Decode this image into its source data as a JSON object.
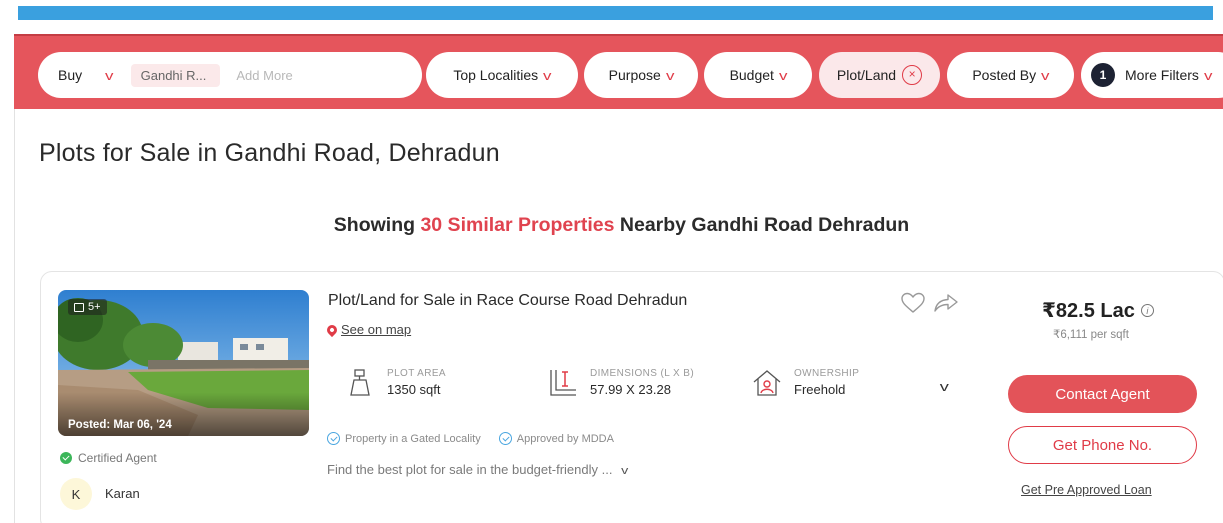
{
  "filters": {
    "buy_label": "Buy",
    "locality_chip": "Gandhi R...",
    "add_more_placeholder": "Add More",
    "top_localities": "Top Localities",
    "purpose": "Purpose",
    "budget": "Budget",
    "plot_land": "Plot/Land",
    "plot_land_clear": "×",
    "posted_by": "Posted By",
    "more_filters_count": "1",
    "more_filters": "More Filters",
    "chevron": "v"
  },
  "page_title": "Plots for Sale in Gandhi Road, Dehradun",
  "showing": {
    "prefix": "Showing ",
    "highlight": "30 Similar Properties",
    "suffix": " Nearby Gandhi Road Dehradun"
  },
  "listing": {
    "photo_count": "5+",
    "posted": "Posted: Mar 06, '24",
    "certified": "Certified Agent",
    "agent_initial": "K",
    "agent_name": "Karan",
    "title": "Plot/Land for Sale in Race Course Road Dehradun",
    "see_on_map": "See on map",
    "specs": {
      "area_label": "PLOT AREA",
      "area_value": "1350 sqft",
      "dim_label": "DIMENSIONS (L X B)",
      "dim_value": "57.99 X 23.28",
      "own_label": "OWNERSHIP",
      "own_value": "Freehold"
    },
    "badge_gated": "Property in a Gated Locality",
    "badge_mdda": "Approved by MDDA",
    "description": "Find the best plot for sale in the budget-friendly ...",
    "price": "₹82.5 Lac",
    "info": "i",
    "per_sqft": "₹6,111 per sqft",
    "contact_btn": "Contact Agent",
    "phone_btn": "Get Phone No.",
    "loan_link": "Get Pre Approved Loan"
  },
  "colors": {
    "brand_red": "#e5555c",
    "accent_red": "#e03b47",
    "top_strip_blue": "#3aa0df",
    "verified_green": "#3cb65a"
  },
  "icons": [
    "chevron-down-icon",
    "close-icon",
    "camera-icon",
    "map-pin-icon",
    "heart-icon",
    "share-icon",
    "plot-area-icon",
    "dimensions-icon",
    "ownership-icon",
    "check-circle-icon",
    "info-icon"
  ]
}
